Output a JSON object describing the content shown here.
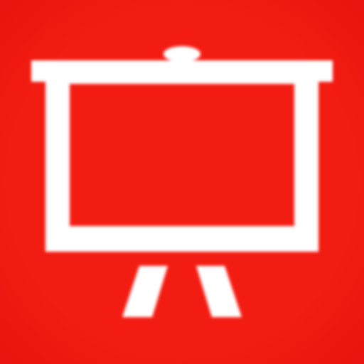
{
  "app_icon": {
    "icon": "presentation-board-icon",
    "colors": {
      "background": "#f31c12",
      "background_edge": "#e8140d",
      "foreground": "#ffffff"
    }
  }
}
